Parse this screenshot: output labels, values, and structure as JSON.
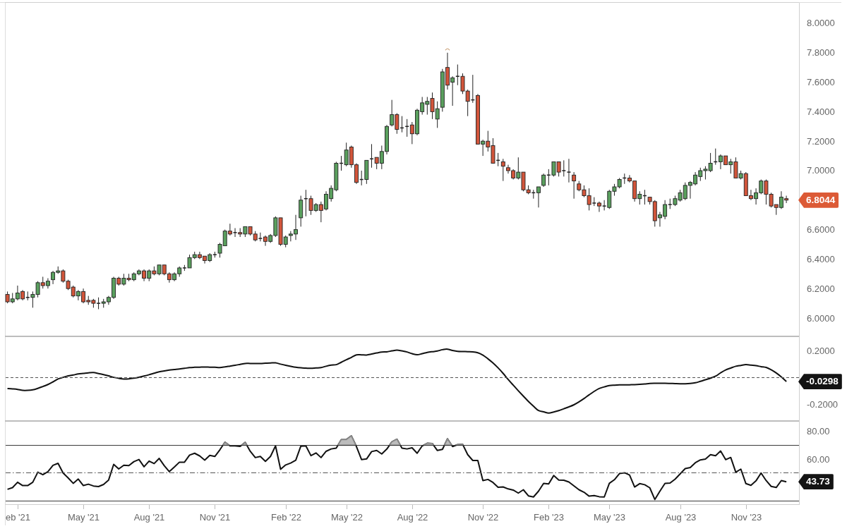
{
  "panels": [
    {
      "value_tag": "6.8044",
      "chart_data": {
        "type": "candlestick",
        "ylim": [
          5.878,
          8.141
        ],
        "yticks": [
          {
            "value": 8,
            "label": "8.0000"
          },
          {
            "value": 7.8,
            "label": "7.8000"
          },
          {
            "value": 7.6,
            "label": "7.6000"
          },
          {
            "value": 7.4,
            "label": "7.4000"
          },
          {
            "value": 7.2,
            "label": "7.2000"
          },
          {
            "value": 7,
            "label": "7.0000"
          },
          {
            "value": 6.6,
            "label": "6.6000"
          },
          {
            "value": 6.4,
            "label": "6.4000"
          },
          {
            "value": 6.2,
            "label": "6.2000"
          },
          {
            "value": 6,
            "label": "6.0000"
          }
        ],
        "categories": [
          null,
          null,
          null,
          null,
          null,
          null,
          null,
          null,
          null,
          null,
          null,
          null,
          null,
          null,
          null,
          null,
          null,
          null,
          null,
          null,
          null,
          null,
          null,
          null,
          null,
          null,
          null,
          null,
          null,
          null,
          null,
          null,
          null,
          null,
          null,
          null,
          null,
          null,
          null,
          null,
          null,
          null,
          null,
          null,
          null,
          null,
          null,
          null,
          null,
          null,
          null,
          null,
          null,
          null,
          null,
          null,
          null,
          null,
          null,
          null,
          null,
          null,
          null,
          null,
          null,
          null,
          null,
          null,
          null,
          null,
          null,
          null,
          null,
          null,
          null,
          null,
          null,
          null,
          null,
          null,
          null,
          null,
          null,
          null,
          null,
          null,
          null,
          null,
          null,
          null,
          null,
          null,
          null,
          null,
          null,
          null,
          null,
          null,
          null,
          null,
          null,
          null,
          null,
          null,
          null,
          null,
          null,
          null,
          null,
          null,
          null,
          null,
          null,
          null,
          null,
          null,
          null,
          null,
          null,
          null,
          null,
          null,
          null,
          null,
          null,
          null,
          null,
          null,
          null,
          null,
          null,
          null,
          null,
          null,
          null,
          null,
          null,
          null,
          null,
          null,
          null,
          null,
          null,
          null,
          null,
          null,
          null,
          null,
          null,
          null,
          null,
          null,
          null,
          null,
          null,
          null,
          null
        ],
        "ohlc": [
          [
            6.16,
            6.18,
            6.1,
            6.11
          ],
          [
            6.11,
            6.17,
            6.1,
            6.13
          ],
          [
            6.13,
            6.22,
            6.12,
            6.17
          ],
          [
            6.18,
            6.19,
            6.12,
            6.13
          ],
          [
            6.14,
            6.18,
            6.12,
            6.14
          ],
          [
            6.14,
            6.18,
            6.07,
            6.16
          ],
          [
            6.16,
            6.25,
            6.14,
            6.24
          ],
          [
            6.24,
            6.28,
            6.2,
            6.22
          ],
          [
            6.22,
            6.27,
            6.2,
            6.25
          ],
          [
            6.26,
            6.32,
            6.23,
            6.31
          ],
          [
            6.31,
            6.35,
            6.3,
            6.32
          ],
          [
            6.32,
            6.33,
            6.24,
            6.25
          ],
          [
            6.25,
            6.26,
            6.19,
            6.2
          ],
          [
            6.21,
            6.22,
            6.14,
            6.15
          ],
          [
            6.15,
            6.19,
            6.12,
            6.18
          ],
          [
            6.18,
            6.2,
            6.1,
            6.11
          ],
          [
            6.12,
            6.15,
            6.09,
            6.11
          ],
          [
            6.12,
            6.13,
            6.07,
            6.1
          ],
          [
            6.1,
            6.14,
            6.06,
            6.1
          ],
          [
            6.1,
            6.13,
            6.07,
            6.11
          ],
          [
            6.11,
            6.15,
            6.09,
            6.14
          ],
          [
            6.14,
            6.28,
            6.13,
            6.27
          ],
          [
            6.27,
            6.28,
            6.22,
            6.23
          ],
          [
            6.23,
            6.3,
            6.22,
            6.27
          ],
          [
            6.27,
            6.3,
            6.25,
            6.26
          ],
          [
            6.26,
            6.31,
            6.25,
            6.3
          ],
          [
            6.3,
            6.33,
            6.29,
            6.32
          ],
          [
            6.32,
            6.33,
            6.25,
            6.27
          ],
          [
            6.27,
            6.33,
            6.25,
            6.32
          ],
          [
            6.32,
            6.35,
            6.29,
            6.3
          ],
          [
            6.3,
            6.36,
            6.29,
            6.36
          ],
          [
            6.36,
            6.36,
            6.29,
            6.3
          ],
          [
            6.3,
            6.31,
            6.24,
            6.26
          ],
          [
            6.26,
            6.31,
            6.25,
            6.3
          ],
          [
            6.3,
            6.35,
            6.28,
            6.34
          ],
          [
            6.34,
            6.36,
            6.32,
            6.34
          ],
          [
            6.34,
            6.43,
            6.34,
            6.41
          ],
          [
            6.41,
            6.45,
            6.4,
            6.43
          ],
          [
            6.43,
            6.45,
            6.4,
            6.41
          ],
          [
            6.42,
            6.42,
            6.37,
            6.39
          ],
          [
            6.39,
            6.44,
            6.38,
            6.43
          ],
          [
            6.43,
            6.45,
            6.41,
            6.43
          ],
          [
            6.44,
            6.51,
            6.41,
            6.5
          ],
          [
            6.49,
            6.6,
            6.49,
            6.59
          ],
          [
            6.59,
            6.64,
            6.56,
            6.57
          ],
          [
            6.58,
            6.61,
            6.55,
            6.58
          ],
          [
            6.58,
            6.61,
            6.55,
            6.57
          ],
          [
            6.57,
            6.62,
            6.55,
            6.62
          ],
          [
            6.62,
            6.62,
            6.56,
            6.57
          ],
          [
            6.57,
            6.59,
            6.52,
            6.53
          ],
          [
            6.54,
            6.58,
            6.52,
            6.54
          ],
          [
            6.55,
            6.56,
            6.49,
            6.52
          ],
          [
            6.52,
            6.57,
            6.51,
            6.56
          ],
          [
            6.56,
            6.69,
            6.55,
            6.68
          ],
          [
            6.68,
            6.68,
            6.49,
            6.5
          ],
          [
            6.5,
            6.56,
            6.48,
            6.55
          ],
          [
            6.56,
            6.59,
            6.52,
            6.57
          ],
          [
            6.57,
            6.7,
            6.53,
            6.6
          ],
          [
            6.68,
            6.83,
            6.62,
            6.8
          ],
          [
            6.81,
            6.87,
            6.69,
            6.81
          ],
          [
            6.81,
            6.83,
            6.7,
            6.73
          ],
          [
            6.73,
            6.78,
            6.72,
            6.77
          ],
          [
            6.77,
            6.79,
            6.65,
            6.73
          ],
          [
            6.74,
            6.86,
            6.73,
            6.84
          ],
          [
            6.81,
            6.9,
            6.79,
            6.88
          ],
          [
            6.87,
            7.06,
            6.86,
            7.05
          ],
          [
            7.05,
            7.1,
            7.0,
            7.05
          ],
          [
            7.04,
            7.19,
            7.03,
            7.14
          ],
          [
            7.16,
            7.17,
            7.02,
            7.04
          ],
          [
            7.04,
            7.05,
            6.91,
            6.92
          ],
          [
            6.94,
            7.0,
            6.9,
            6.94
          ],
          [
            6.94,
            7.07,
            6.91,
            7.07
          ],
          [
            7.08,
            7.18,
            7.02,
            7.08
          ],
          [
            7.09,
            7.09,
            7.01,
            7.05
          ],
          [
            7.05,
            7.17,
            7.01,
            7.13
          ],
          [
            7.13,
            7.31,
            7.11,
            7.3
          ],
          [
            7.31,
            7.48,
            7.3,
            7.38
          ],
          [
            7.38,
            7.39,
            7.25,
            7.28
          ],
          [
            7.29,
            7.37,
            7.26,
            7.29
          ],
          [
            7.3,
            7.35,
            7.23,
            7.3
          ],
          [
            7.31,
            7.33,
            7.18,
            7.25
          ],
          [
            7.25,
            7.42,
            7.24,
            7.41
          ],
          [
            7.4,
            7.5,
            7.38,
            7.46
          ],
          [
            7.45,
            7.5,
            7.38,
            7.47
          ],
          [
            7.49,
            7.53,
            7.35,
            7.4
          ],
          [
            7.35,
            7.47,
            7.29,
            7.42
          ],
          [
            7.43,
            7.69,
            7.4,
            7.67
          ],
          [
            7.7,
            7.8,
            7.55,
            7.58
          ],
          [
            7.6,
            7.64,
            7.44,
            7.63
          ],
          [
            7.64,
            7.72,
            7.58,
            7.64
          ],
          [
            7.64,
            7.66,
            7.52,
            7.54
          ],
          [
            7.54,
            7.55,
            7.37,
            7.47
          ],
          [
            7.48,
            7.65,
            7.46,
            7.48
          ],
          [
            7.51,
            7.52,
            7.18,
            7.18
          ],
          [
            7.18,
            7.21,
            7.1,
            7.2
          ],
          [
            7.2,
            7.27,
            7.13,
            7.16
          ],
          [
            7.17,
            7.22,
            7.05,
            7.05
          ],
          [
            7.07,
            7.12,
            7.03,
            7.07
          ],
          [
            7.06,
            7.08,
            6.93,
            7.03
          ],
          [
            7.02,
            7.04,
            6.98,
            7.0
          ],
          [
            7.0,
            7.01,
            6.94,
            6.95
          ],
          [
            6.95,
            7.09,
            6.94,
            6.99
          ],
          [
            6.99,
            6.99,
            6.86,
            6.87
          ],
          [
            6.87,
            6.9,
            6.84,
            6.85
          ],
          [
            6.85,
            6.87,
            6.81,
            6.85
          ],
          [
            6.85,
            6.89,
            6.75,
            6.89
          ],
          [
            6.9,
            6.98,
            6.89,
            6.97
          ],
          [
            6.97,
            7.01,
            6.9,
            6.97
          ],
          [
            6.97,
            7.06,
            6.96,
            7.06
          ],
          [
            7.06,
            7.06,
            6.96,
            6.99
          ],
          [
            7.0,
            7.07,
            6.96,
            7.0
          ],
          [
            6.99,
            7.08,
            6.92,
            6.99
          ],
          [
            6.97,
            6.99,
            6.81,
            6.93
          ],
          [
            6.91,
            6.93,
            6.86,
            6.87
          ],
          [
            6.87,
            6.9,
            6.82,
            6.83
          ],
          [
            6.83,
            6.88,
            6.73,
            6.77
          ],
          [
            6.78,
            6.82,
            6.76,
            6.78
          ],
          [
            6.78,
            6.79,
            6.72,
            6.76
          ],
          [
            6.76,
            6.8,
            6.73,
            6.76
          ],
          [
            6.75,
            6.87,
            6.74,
            6.86
          ],
          [
            6.86,
            6.91,
            6.83,
            6.89
          ],
          [
            6.89,
            6.95,
            6.88,
            6.94
          ],
          [
            6.95,
            6.98,
            6.91,
            6.95
          ],
          [
            6.95,
            6.97,
            6.92,
            6.93
          ],
          [
            6.93,
            6.93,
            6.79,
            6.81
          ],
          [
            6.81,
            6.86,
            6.77,
            6.84
          ],
          [
            6.83,
            6.87,
            6.77,
            6.83
          ],
          [
            6.82,
            6.82,
            6.77,
            6.79
          ],
          [
            6.79,
            6.8,
            6.62,
            6.66
          ],
          [
            6.68,
            6.72,
            6.62,
            6.7
          ],
          [
            6.69,
            6.8,
            6.67,
            6.77
          ],
          [
            6.77,
            6.81,
            6.74,
            6.77
          ],
          [
            6.77,
            6.83,
            6.76,
            6.81
          ],
          [
            6.8,
            6.87,
            6.79,
            6.85
          ],
          [
            6.81,
            6.92,
            6.8,
            6.9
          ],
          [
            6.9,
            6.93,
            6.81,
            6.92
          ],
          [
            6.91,
            6.99,
            6.9,
            6.97
          ],
          [
            6.96,
            7.02,
            6.93,
            7.0
          ],
          [
            7.0,
            7.03,
            6.94,
            7.01
          ],
          [
            7.0,
            7.12,
            6.99,
            7.05
          ],
          [
            7.06,
            7.15,
            7.04,
            7.06
          ],
          [
            7.06,
            7.11,
            7.01,
            7.1
          ],
          [
            7.1,
            7.1,
            7.04,
            7.04
          ],
          [
            7.04,
            7.08,
            6.98,
            7.06
          ],
          [
            7.06,
            7.09,
            6.95,
            6.95
          ],
          [
            6.95,
            7.0,
            6.94,
            6.98
          ],
          [
            6.98,
            6.99,
            6.83,
            6.83
          ],
          [
            6.83,
            6.87,
            6.8,
            6.81
          ],
          [
            6.81,
            6.88,
            6.77,
            6.85
          ],
          [
            6.85,
            6.94,
            6.84,
            6.93
          ],
          [
            6.93,
            6.94,
            6.77,
            6.84
          ],
          [
            6.84,
            6.85,
            6.75,
            6.76
          ],
          [
            6.77,
            6.77,
            6.7,
            6.75
          ],
          [
            6.75,
            6.86,
            6.74,
            6.82
          ],
          [
            6.81,
            6.83,
            6.78,
            6.8
          ],
          null,
          null
        ]
      }
    },
    {
      "value_tag": "-0.0298",
      "chart_data": {
        "type": "line",
        "ylim": [
          -0.325,
          0.309
        ],
        "yticks": [
          {
            "value": 0.2,
            "label": "0.2000"
          },
          {
            "value": -0.2,
            "label": "-0.2000"
          }
        ],
        "ref_lines": [
          {
            "axis": "y",
            "value": 0
          }
        ],
        "categories": [
          null,
          null,
          null,
          null,
          null,
          null,
          null,
          null,
          null,
          null,
          null,
          null,
          null,
          null,
          null,
          null,
          null,
          null,
          null,
          null,
          null,
          null,
          null,
          null,
          null,
          null,
          null,
          null,
          null,
          null,
          null,
          null,
          null,
          null,
          null,
          null,
          null,
          null,
          null,
          null,
          null,
          null,
          null,
          null,
          null,
          null,
          null,
          null,
          null,
          null,
          null,
          null,
          null,
          null,
          null,
          null,
          null,
          null,
          null,
          null,
          null,
          null,
          null,
          null,
          null,
          null,
          null,
          null,
          null,
          null,
          null,
          null,
          null,
          null,
          null,
          null,
          null,
          null,
          null,
          null,
          null,
          null,
          null,
          null,
          null,
          null,
          null,
          null,
          null,
          null,
          null,
          null,
          null,
          null,
          null,
          null,
          null,
          null,
          null,
          null,
          null,
          null,
          null,
          null,
          null,
          null,
          null,
          null,
          null,
          null,
          null,
          null,
          null,
          null,
          null,
          null,
          null,
          null,
          null,
          null,
          null,
          null,
          null,
          null,
          null,
          null,
          null,
          null,
          null,
          null,
          null,
          null,
          null,
          null,
          null,
          null,
          null,
          null,
          null,
          null,
          null,
          null,
          null,
          null,
          null,
          null,
          null,
          null,
          null,
          null,
          null,
          null,
          null,
          null,
          null,
          null,
          null
        ],
        "series": [
          {
            "values": [
              -0.082,
              -0.085,
              -0.089,
              -0.096,
              -0.096,
              -0.092,
              -0.081,
              -0.067,
              -0.052,
              -0.032,
              -0.01,
              0.002,
              0.013,
              0.02,
              0.028,
              0.032,
              0.036,
              0.038,
              0.031,
              0.023,
              0.013,
              0.002,
              -0.005,
              -0.01,
              -0.009,
              -0.004,
              0.003,
              0.012,
              0.022,
              0.033,
              0.044,
              0.051,
              0.057,
              0.061,
              0.065,
              0.07,
              0.076,
              0.078,
              0.079,
              0.08,
              0.079,
              0.078,
              0.076,
              0.081,
              0.087,
              0.093,
              0.1,
              0.107,
              0.107,
              0.107,
              0.107,
              0.109,
              0.111,
              0.112,
              0.102,
              0.093,
              0.085,
              0.078,
              0.074,
              0.072,
              0.07,
              0.073,
              0.076,
              0.086,
              0.094,
              0.098,
              0.116,
              0.135,
              0.153,
              0.172,
              0.172,
              0.171,
              0.178,
              0.186,
              0.193,
              0.195,
              0.202,
              0.208,
              0.202,
              0.194,
              0.181,
              0.173,
              0.181,
              0.19,
              0.196,
              0.201,
              0.211,
              0.215,
              0.205,
              0.198,
              0.197,
              0.196,
              0.195,
              0.188,
              0.17,
              0.142,
              0.111,
              0.074,
              0.032,
              -0.014,
              -0.057,
              -0.099,
              -0.14,
              -0.18,
              -0.216,
              -0.249,
              -0.258,
              -0.268,
              -0.26,
              -0.249,
              -0.235,
              -0.221,
              -0.205,
              -0.183,
              -0.158,
              -0.13,
              -0.104,
              -0.082,
              -0.07,
              -0.06,
              -0.057,
              -0.055,
              -0.055,
              -0.054,
              -0.053,
              -0.051,
              -0.048,
              -0.044,
              -0.043,
              -0.043,
              -0.043,
              -0.044,
              -0.045,
              -0.046,
              -0.046,
              -0.044,
              -0.039,
              -0.028,
              -0.016,
              -0.004,
              0.011,
              0.036,
              0.058,
              0.072,
              0.086,
              0.092,
              0.098,
              0.094,
              0.09,
              0.083,
              0.077,
              0.059,
              0.035,
              0.005,
              -0.03,
              null,
              null
            ]
          }
        ]
      }
    },
    {
      "value_tag": "43.73",
      "chart_data": {
        "type": "line",
        "ylim": [
          27.37,
          87.11
        ],
        "yticks": [
          {
            "value": 80,
            "label": "80.00"
          },
          {
            "value": 60,
            "label": "60.00"
          }
        ],
        "ref_lines": [
          {
            "axis": "y",
            "value": 70
          },
          {
            "axis": "y",
            "value": 50
          },
          {
            "axis": "y",
            "value": 30
          }
        ],
        "categories": [
          null,
          null,
          "eb '21",
          null,
          null,
          null,
          null,
          null,
          null,
          null,
          null,
          null,
          null,
          null,
          null,
          "May '21",
          null,
          null,
          null,
          null,
          null,
          null,
          null,
          null,
          null,
          null,
          null,
          null,
          "Aug '21",
          null,
          null,
          null,
          null,
          null,
          null,
          null,
          null,
          null,
          null,
          null,
          null,
          "Nov '21",
          null,
          null,
          null,
          null,
          null,
          null,
          null,
          null,
          null,
          null,
          null,
          null,
          null,
          "Feb '22",
          null,
          null,
          null,
          null,
          null,
          null,
          null,
          null,
          null,
          null,
          null,
          "May '22",
          null,
          null,
          null,
          null,
          null,
          null,
          null,
          null,
          null,
          null,
          null,
          null,
          "Aug '22",
          null,
          null,
          null,
          null,
          null,
          null,
          null,
          null,
          null,
          null,
          null,
          null,
          null,
          "Nov '22",
          null,
          null,
          null,
          null,
          null,
          null,
          null,
          null,
          null,
          null,
          null,
          null,
          "Feb '23",
          null,
          null,
          null,
          null,
          null,
          null,
          null,
          null,
          null,
          null,
          null,
          "May '23",
          null,
          null,
          null,
          null,
          null,
          null,
          null,
          null,
          null,
          null,
          null,
          null,
          null,
          "Aug '23",
          null,
          null,
          null,
          null,
          null,
          null,
          null,
          null,
          null,
          null,
          null,
          null,
          "Nov '23",
          null,
          null,
          null,
          null,
          null,
          null,
          null,
          null,
          null,
          null
        ],
        "series": [
          {
            "values": [
              38.3,
              39.5,
              43.4,
              41,
              41,
              43.4,
              50.6,
              48.8,
              51,
              55.5,
              57,
              50,
              46.5,
              42.6,
              45.7,
              41,
              42,
              40.7,
              40.3,
              41.8,
              45,
              56.2,
              52.9,
              55.6,
              55.3,
              58.2,
              59.7,
              54.5,
              58.6,
              56.8,
              60.5,
              55.3,
              51,
              54.3,
              57.8,
              57.8,
              62.9,
              64.2,
              62.3,
              59.3,
              62.7,
              61.9,
              66.7,
              72.2,
              69.5,
              69.5,
              69.1,
              72,
              65.6,
              61.1,
              61.9,
              58.4,
              61.9,
              69.5,
              52.7,
              55.8,
              57.2,
              59.2,
              69.3,
              69.5,
              62.5,
              64.4,
              61.1,
              65.6,
              67.3,
              67.9,
              74,
              74,
              76.7,
              69,
              59.7,
              60.1,
              65.4,
              66.2,
              63.7,
              67.2,
              72.4,
              74.3,
              67.9,
              67.3,
              68.1,
              64.2,
              69.5,
              71.4,
              71.2,
              66.2,
              67,
              74.6,
              69,
              70.4,
              70.6,
              63.2,
              59,
              59,
              44.6,
              45.4,
              43.2,
              39.8,
              40,
              38.6,
              37.8,
              35.6,
              38,
              33.6,
              32.8,
              37,
              42.6,
              42.2,
              48.2,
              45,
              44.8,
              43.6,
              40.8,
              38,
              36.2,
              33.4,
              33.8,
              33,
              32.8,
              42.6,
              45.2,
              49.6,
              50.2,
              48.6,
              40,
              42.4,
              41.6,
              39.4,
              31,
              37,
              42.6,
              42.8,
              45.6,
              49.4,
              53.2,
              54,
              57.4,
              59.4,
              60,
              63.2,
              62.4,
              65.8,
              59.6,
              61.2,
              50.6,
              52.8,
              42.4,
              41.2,
              44.4,
              50,
              44.6,
              40.4,
              39.6,
              44.6,
              43.7,
              null,
              null
            ]
          }
        ]
      }
    }
  ]
}
